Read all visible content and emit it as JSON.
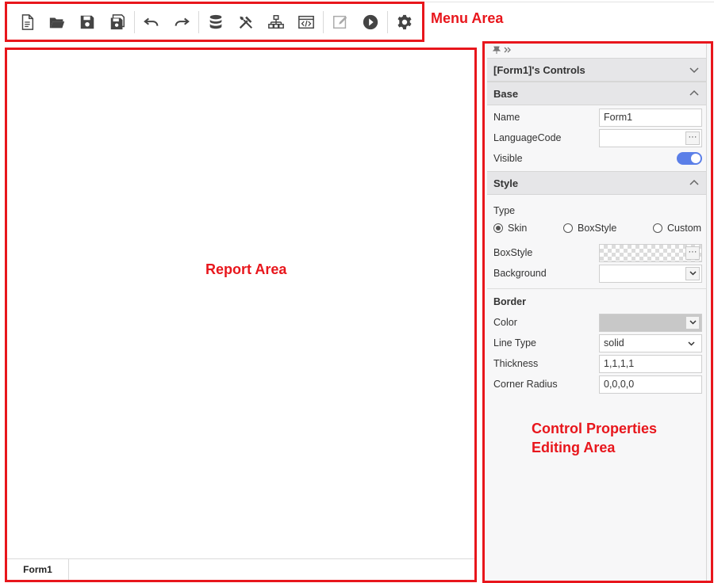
{
  "toolbar": {
    "icons": [
      "new-file-icon",
      "open-folder-icon",
      "save-icon",
      "save-all-icon",
      "undo-icon",
      "redo-icon",
      "database-icon",
      "tools-icon",
      "hierarchy-icon",
      "code-view-icon",
      "edit-icon",
      "run-icon",
      "settings-icon"
    ]
  },
  "callouts": {
    "menu_area": "Menu Area",
    "report_area": "Report Area",
    "properties_area_line1": "Control Properties",
    "properties_area_line2": "Editing Area"
  },
  "report": {
    "tabs": [
      {
        "label": "Form1"
      }
    ]
  },
  "panel": {
    "pin_glyph": "▼ »",
    "controls_header": "[Form1]'s Controls",
    "base": {
      "title": "Base",
      "name_label": "Name",
      "name_value": "Form1",
      "language_label": "LanguageCode",
      "language_value": "",
      "visible_label": "Visible",
      "visible_on": true
    },
    "style": {
      "title": "Style",
      "type_label": "Type",
      "type_options": [
        "Skin",
        "BoxStyle",
        "Custom"
      ],
      "type_selected": "Skin",
      "boxstyle_label": "BoxStyle",
      "background_label": "Background"
    },
    "border": {
      "title": "Border",
      "color_label": "Color",
      "color_value": "#c8c8c8",
      "linetype_label": "Line Type",
      "linetype_value": "solid",
      "thickness_label": "Thickness",
      "thickness_value": "1,1,1,1",
      "radius_label": "Corner Radius",
      "radius_value": "0,0,0,0"
    }
  },
  "colors": {
    "annotation": "#e8161c",
    "toggle_on": "#5b7fe8",
    "icon": "#444444"
  }
}
